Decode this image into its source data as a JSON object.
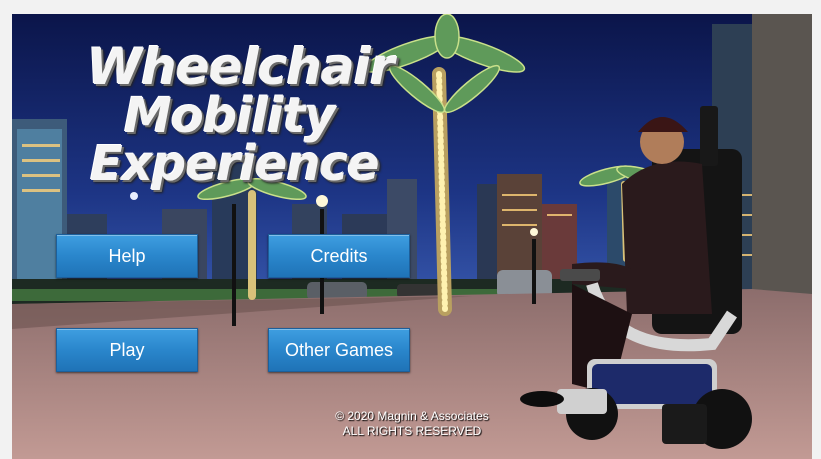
{
  "game": {
    "title_lines": [
      "Wheelchair",
      "Mobility",
      "Experience"
    ]
  },
  "menu": {
    "help_label": "Help",
    "credits_label": "Credits",
    "play_label": "Play",
    "other_games_label": "Other Games"
  },
  "footer": {
    "copyright_line1": "© 2020  Magnin & Associates",
    "copyright_line2": "ALL RIGHTS RESERVED"
  },
  "colors": {
    "button_blue": "#2a86cc",
    "sky_top": "#0d1850",
    "sky_bottom": "#2a4aa0",
    "pavement": "#b38a86"
  }
}
